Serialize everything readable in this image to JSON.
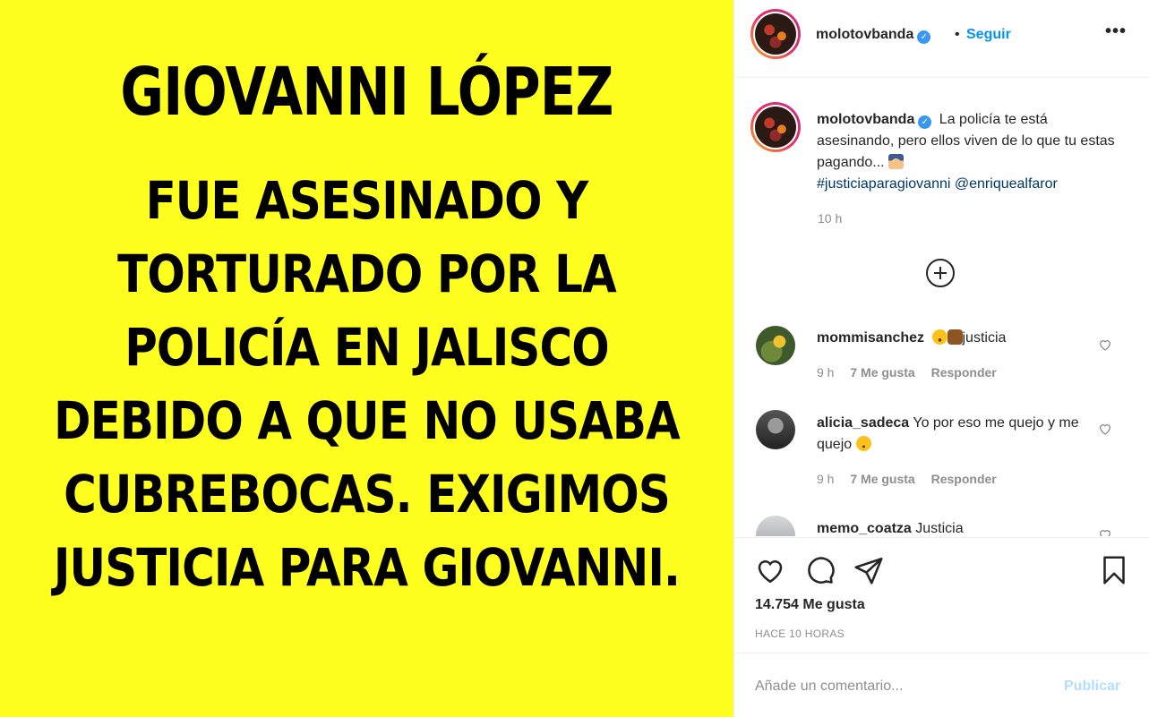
{
  "post_image": {
    "background": "#ffff1f",
    "lines": [
      "GIOVANNI LÓPEZ",
      "FUE ASESINADO Y",
      "TORTURADO POR LA",
      "POLICÍA EN JALISCO",
      "DEBIDO A QUE NO USABA",
      "CUBREBOCAS. EXIGIMOS",
      "JUSTICIA PARA GIOVANNI."
    ]
  },
  "header": {
    "username": "molotovbanda",
    "verified_icon": "verified-badge-icon",
    "separator": "•",
    "follow_label": "Seguir",
    "more_label": "•••"
  },
  "caption": {
    "username": "molotovbanda",
    "text": "La policía te está asesinando, pero ellos viven de lo que tu estas pagando...",
    "emoji_icon": "police-officer-emoji",
    "hashtag": "#justiciaparagiovanni",
    "mention": "@enriquealfaror",
    "time": "10 h"
  },
  "load_more_icon": "plus-circle-icon",
  "comments": [
    {
      "username": "mommisanchez",
      "emoji_icons": [
        "fearful-face-emoji",
        "raised-fist-emoji"
      ],
      "text": "justicia",
      "time": "9 h",
      "likes": "7 Me gusta",
      "reply": "Responder"
    },
    {
      "username": "alicia_sadeca",
      "text": "Yo por eso me quejo y me quejo",
      "emoji_icons": [
        "persevering-face-emoji"
      ],
      "time": "9 h",
      "likes": "7 Me gusta",
      "reply": "Responder"
    },
    {
      "username": "memo_coatza",
      "text": "Justicia"
    }
  ],
  "actions": {
    "icons": [
      "heart-icon",
      "comment-icon",
      "share-icon",
      "bookmark-icon"
    ],
    "likes": "14.754 Me gusta",
    "ago": "HACE 10 HORAS"
  },
  "add_comment": {
    "placeholder": "Añade un comentario...",
    "publish_label": "Publicar"
  },
  "colors": {
    "accent": "#0095f6",
    "link": "#00376b",
    "muted": "#8e8e8e",
    "publish_disabled": "#b2dffc"
  }
}
